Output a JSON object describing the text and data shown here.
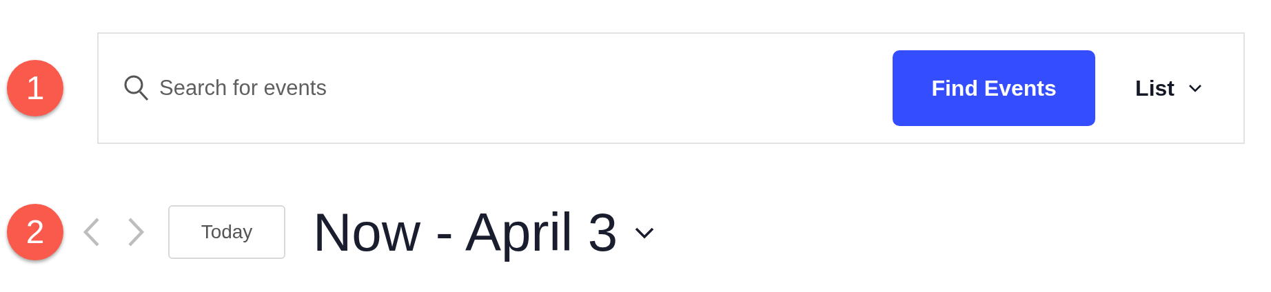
{
  "steps": [
    {
      "number": "1",
      "search": {
        "placeholder": "Search for events"
      },
      "find_button": "Find Events",
      "view": {
        "label": "List"
      }
    },
    {
      "number": "2",
      "today_button": "Today",
      "date_range": "Now - April 3"
    }
  ]
}
